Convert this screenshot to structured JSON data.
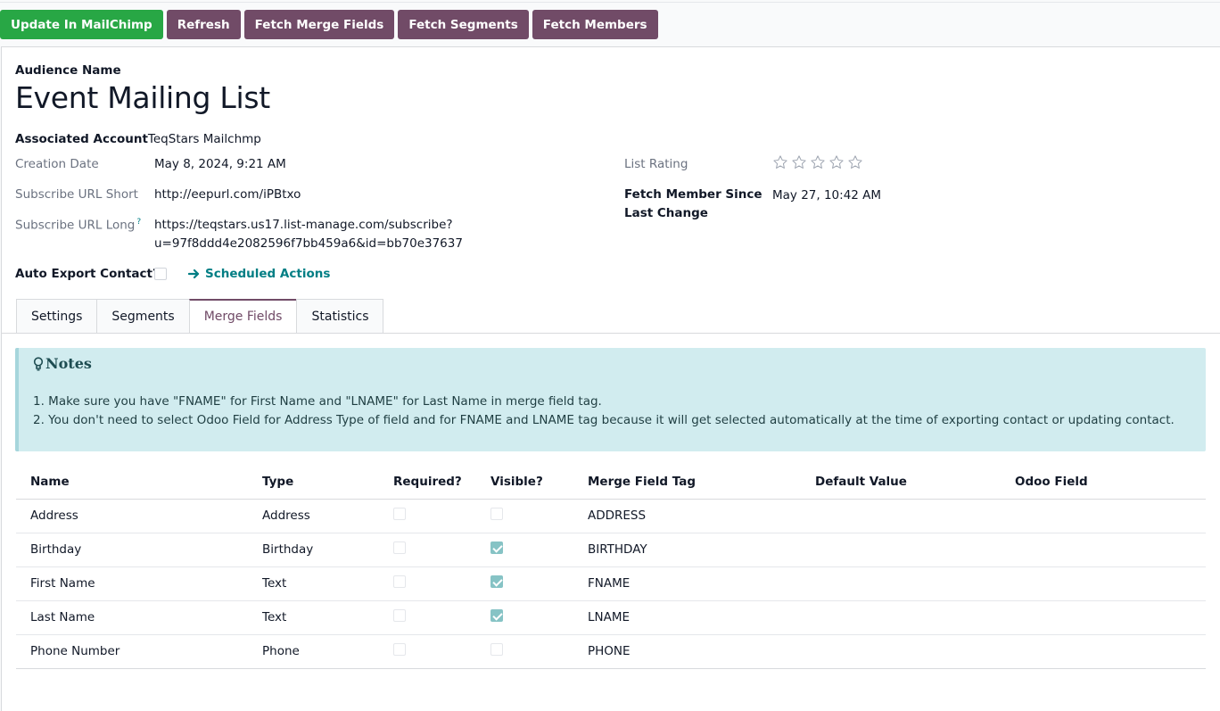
{
  "toolbar": {
    "update_label": "Update In MailChimp",
    "refresh_label": "Refresh",
    "fetch_merge_fields_label": "Fetch Merge Fields",
    "fetch_segments_label": "Fetch Segments",
    "fetch_members_label": "Fetch Members"
  },
  "form": {
    "audience_name_label": "Audience Name",
    "audience_name": "Event Mailing List",
    "associated_account_label": "Associated Account",
    "associated_account": "TeqStars Mailchmp",
    "creation_date_label": "Creation Date",
    "creation_date": "May 8, 2024, 9:21 AM",
    "subscribe_url_short_label": "Subscribe URL Short",
    "subscribe_url_short": "http://eepurl.com/iPBtxo",
    "subscribe_url_long_label": "Subscribe URL Long",
    "subscribe_url_long_help": "?",
    "subscribe_url_long_line1": "https://teqstars.us17.list-manage.com/subscribe?",
    "subscribe_url_long_line2": "u=97f8ddd4e2082596f7bb459a6&id=bb70e37637",
    "auto_export_label": "Auto Export Contact?",
    "auto_export_checked": false,
    "scheduled_actions_label": "Scheduled Actions",
    "list_rating_label": "List Rating",
    "list_rating": 0,
    "list_rating_max": 5,
    "fetch_member_since_label_line1": "Fetch Member Since",
    "fetch_member_since_label_line2": "Last Change",
    "fetch_member_since": "May 27, 10:42 AM"
  },
  "tabs": [
    {
      "label": "Settings",
      "active": false
    },
    {
      "label": "Segments",
      "active": false
    },
    {
      "label": "Merge Fields",
      "active": true
    },
    {
      "label": "Statistics",
      "active": false
    }
  ],
  "notes": {
    "title": "Notes",
    "line1": "1. Make sure you have \"FNAME\" for First Name and \"LNAME\" for Last Name in merge field tag.",
    "line2": "2. You don't need to select Odoo Field for Address Type of field and for FNAME and LNAME tag because it will get selected automatically at the time of exporting contact or updating contact."
  },
  "table": {
    "columns": [
      "Name",
      "Type",
      "Required?",
      "Visible?",
      "Merge Field Tag",
      "Default Value",
      "Odoo Field"
    ],
    "rows": [
      {
        "name": "Address",
        "type": "Address",
        "required": false,
        "visible": false,
        "tag": "ADDRESS",
        "default": "",
        "odoo_field": ""
      },
      {
        "name": "Birthday",
        "type": "Birthday",
        "required": false,
        "visible": true,
        "tag": "BIRTHDAY",
        "default": "",
        "odoo_field": ""
      },
      {
        "name": "First Name",
        "type": "Text",
        "required": false,
        "visible": true,
        "tag": "FNAME",
        "default": "",
        "odoo_field": ""
      },
      {
        "name": "Last Name",
        "type": "Text",
        "required": false,
        "visible": true,
        "tag": "LNAME",
        "default": "",
        "odoo_field": ""
      },
      {
        "name": "Phone Number",
        "type": "Phone",
        "required": false,
        "visible": false,
        "tag": "PHONE",
        "default": "",
        "odoo_field": ""
      }
    ]
  },
  "colors": {
    "primary_green": "#28a745",
    "odoo_purple": "#714b67",
    "teal_link": "#017e84",
    "notes_bg": "#d1ecef",
    "checked_box": "#86c3c5"
  }
}
